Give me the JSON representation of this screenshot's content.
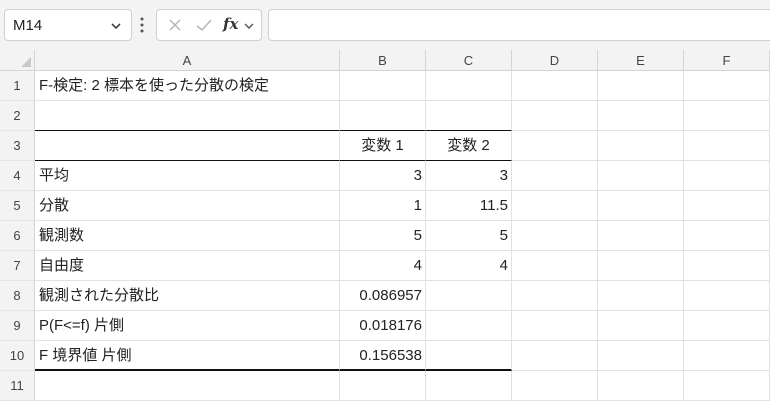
{
  "formula_bar": {
    "name_box": "M14",
    "formula": ""
  },
  "columns": [
    "A",
    "B",
    "C",
    "D",
    "E",
    "F"
  ],
  "rows": [
    {
      "num": "1",
      "a": "F-検定: 2 標本を使った分散の検定",
      "b": "",
      "c": ""
    },
    {
      "num": "2",
      "a": "",
      "b": "",
      "c": ""
    },
    {
      "num": "3",
      "a": "",
      "b": "変数 1",
      "c": "変数 2"
    },
    {
      "num": "4",
      "a": "平均",
      "b": "3",
      "c": "3"
    },
    {
      "num": "5",
      "a": "分散",
      "b": "1",
      "c": "11.5"
    },
    {
      "num": "6",
      "a": "観測数",
      "b": "5",
      "c": "5"
    },
    {
      "num": "7",
      "a": "自由度",
      "b": "4",
      "c": "4"
    },
    {
      "num": "8",
      "a": "観測された分散比",
      "b": "0.086957",
      "c": ""
    },
    {
      "num": "9",
      "a": "P(F<=f) 片側",
      "b": "0.018176",
      "c": ""
    },
    {
      "num": "10",
      "a": "F 境界値 片側",
      "b": "0.156538",
      "c": ""
    },
    {
      "num": "11",
      "a": "",
      "b": "",
      "c": ""
    }
  ],
  "colors": {
    "header_bg": "#f3f3f3",
    "gridline": "#e1e1e1",
    "border_dark": "#111111"
  }
}
